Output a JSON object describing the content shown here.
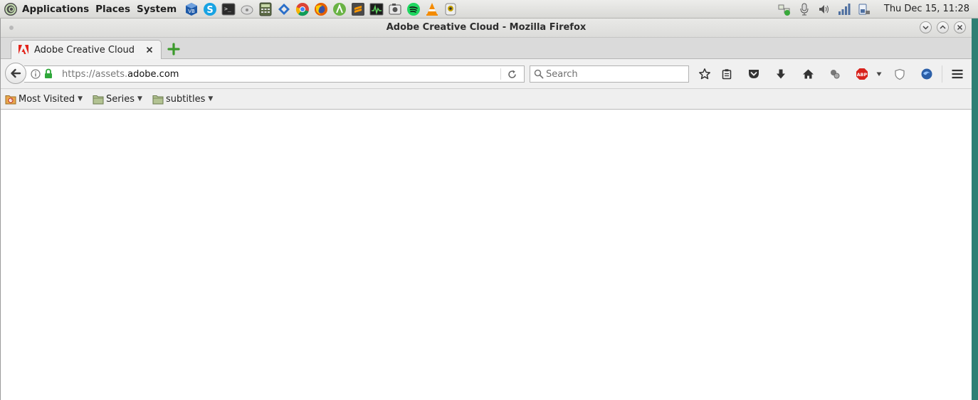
{
  "panel": {
    "menus": [
      "Applications",
      "Places",
      "System"
    ],
    "launchers": [
      "virtualbox-icon",
      "skype-icon",
      "terminal-icon",
      "disk-icon",
      "calculator-icon",
      "remmina-icon",
      "chrome-icon",
      "firefox-icon",
      "android-studio-icon",
      "sublime-text-icon",
      "system-monitor-icon",
      "screenshot-icon",
      "spotify-icon",
      "vlc-icon",
      "webcam-icon"
    ],
    "tray": [
      "network-status-icon",
      "microphone-icon",
      "volume-icon",
      "signal-icon",
      "battery-icon"
    ],
    "clock": "Thu Dec 15, 11:28"
  },
  "window": {
    "title": "Adobe Creative Cloud - Mozilla Firefox"
  },
  "tabs": [
    {
      "title": "Adobe Creative Cloud",
      "favicon": "adobe-icon",
      "active": true
    }
  ],
  "navbar": {
    "url_scheme": "https://assets.",
    "url_host": "adobe.com",
    "search_placeholder": "Search"
  },
  "bookmarks": [
    {
      "label": "Most Visited",
      "icon": "most-visited-icon"
    },
    {
      "label": "Series",
      "icon": "folder-icon"
    },
    {
      "label": "subtitles",
      "icon": "folder-icon"
    }
  ],
  "colors": {
    "desktop": "#2f7f74",
    "adobe_red": "#e2231a",
    "abp_red": "#d8231d",
    "lock_green": "#2fa83a",
    "newtab_green": "#3c9a2c"
  }
}
